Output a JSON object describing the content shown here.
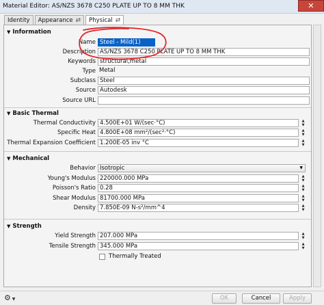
{
  "window": {
    "title": "Material Editor: AS/NZS 3678 C250 PLATE UP TO 8 MM THK",
    "close_glyph": "✕"
  },
  "tabs": [
    {
      "label": "Identity"
    },
    {
      "label": "Appearance",
      "icon": "swap-icon"
    },
    {
      "label": "Physical",
      "icon": "swap-icon",
      "active": true
    }
  ],
  "sections": {
    "information": {
      "title": "Information",
      "rows": [
        {
          "label": "Name",
          "value": "Steel - Mild(1)"
        },
        {
          "label": "Description",
          "value": "AS/NZS 3678 C250 PLATE UP TO 8 MM THK"
        },
        {
          "label": "Keywords",
          "value": "structural,metal"
        },
        {
          "label": "Type",
          "value": "Metal"
        },
        {
          "label": "Subclass",
          "value": "Steel"
        },
        {
          "label": "Source",
          "value": "Autodesk"
        },
        {
          "label": "Source URL",
          "value": ""
        }
      ]
    },
    "basic_thermal": {
      "title": "Basic Thermal",
      "rows": [
        {
          "label": "Thermal Conductivity",
          "value": "4.500E+01 W/(sec·°C)"
        },
        {
          "label": "Specific Heat",
          "value": "4.800E+08 mm²/(sec²·°C)"
        },
        {
          "label": "Thermal Expansion Coefficient",
          "value": "1.200E-05 inv °C"
        }
      ]
    },
    "mechanical": {
      "title": "Mechanical",
      "rows": [
        {
          "label": "Behavior",
          "value": "Isotropic"
        },
        {
          "label": "Young's Modulus",
          "value": "220000.000 MPa"
        },
        {
          "label": "Poisson's Ratio",
          "value": "0.28"
        },
        {
          "label": "Shear Modulus",
          "value": "81700.000 MPa"
        },
        {
          "label": "Density",
          "value": "7.850E-09 N-s²/mm^4"
        }
      ]
    },
    "strength": {
      "title": "Strength",
      "rows": [
        {
          "label": "Yield Strength",
          "value": "207.000 MPa"
        },
        {
          "label": "Tensile Strength",
          "value": "345.000 MPa"
        }
      ],
      "checkbox_label": "Thermally Treated",
      "checkbox_checked": false
    }
  },
  "footer": {
    "ok": "OK",
    "cancel": "Cancel",
    "apply": "Apply",
    "options_icon": "gear-icon"
  },
  "colors": {
    "selection": "#0a62c8",
    "annotation": "#e0252a",
    "close": "#c7463c"
  }
}
